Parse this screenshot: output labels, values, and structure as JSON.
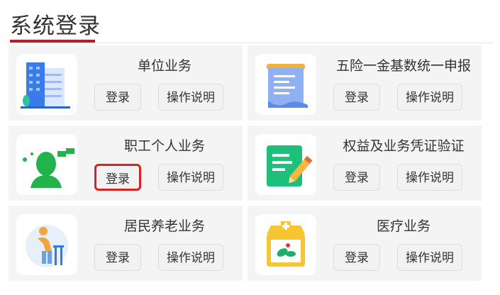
{
  "page": {
    "title": "系统登录"
  },
  "cards": [
    {
      "title": "单位业务",
      "login_label": "登录",
      "help_label": "操作说明",
      "icon": "office-building-icon"
    },
    {
      "title": "五险一金基数统一申报",
      "login_label": "登录",
      "help_label": "操作说明",
      "icon": "document-scroll-icon"
    },
    {
      "title": "职工个人业务",
      "login_label": "登录",
      "help_label": "操作说明",
      "icon": "person-chat-icon",
      "login_highlighted": true
    },
    {
      "title": "权益及业务凭证验证",
      "login_label": "登录",
      "help_label": "操作说明",
      "icon": "certificate-pencil-icon"
    },
    {
      "title": "居民养老业务",
      "login_label": "登录",
      "help_label": "操作说明",
      "icon": "elderly-walker-icon"
    },
    {
      "title": "医疗业务",
      "login_label": "登录",
      "help_label": "操作说明",
      "icon": "pharmacy-store-icon"
    }
  ],
  "colors": {
    "accent": "#b21e2f",
    "highlight": "#e0201c",
    "card_bg": "#f4f4f4"
  }
}
